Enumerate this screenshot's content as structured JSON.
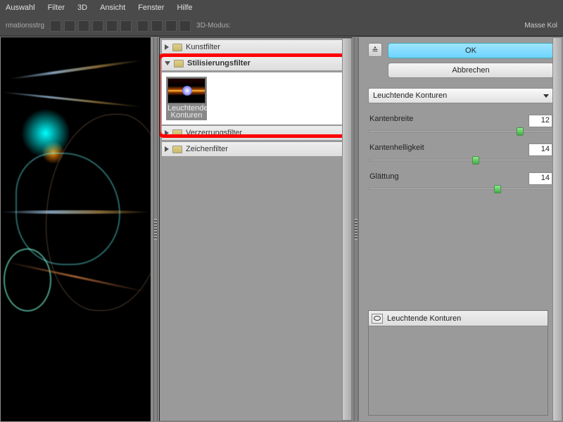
{
  "menu": {
    "items": [
      "Auswahl",
      "Filter",
      "3D",
      "Ansicht",
      "Fenster",
      "Hilfe"
    ]
  },
  "toolbar": {
    "label": "rmationsstrg",
    "mode3d": "3D-Modus:",
    "panel_hint": "Masse Kol"
  },
  "filters": {
    "cat0": "Kunstfilter",
    "cat1": "Stilisierungsfilter",
    "thumb_label1": "Leuchtende",
    "thumb_label2": "Konturen",
    "cat2": "Verzerrungsfilter",
    "cat3": "Zeichenfilter"
  },
  "controls": {
    "ok": "OK",
    "cancel": "Abbrechen",
    "effect_dropdown": "Leuchtende Konturen",
    "sliders": [
      {
        "label": "Kantenbreite",
        "value": "12",
        "pos": 82
      },
      {
        "label": "Kantenhelligkeit",
        "value": "14",
        "pos": 58
      },
      {
        "label": "Glättung",
        "value": "14",
        "pos": 70
      }
    ]
  },
  "layers": {
    "active": "Leuchtende Konturen"
  }
}
